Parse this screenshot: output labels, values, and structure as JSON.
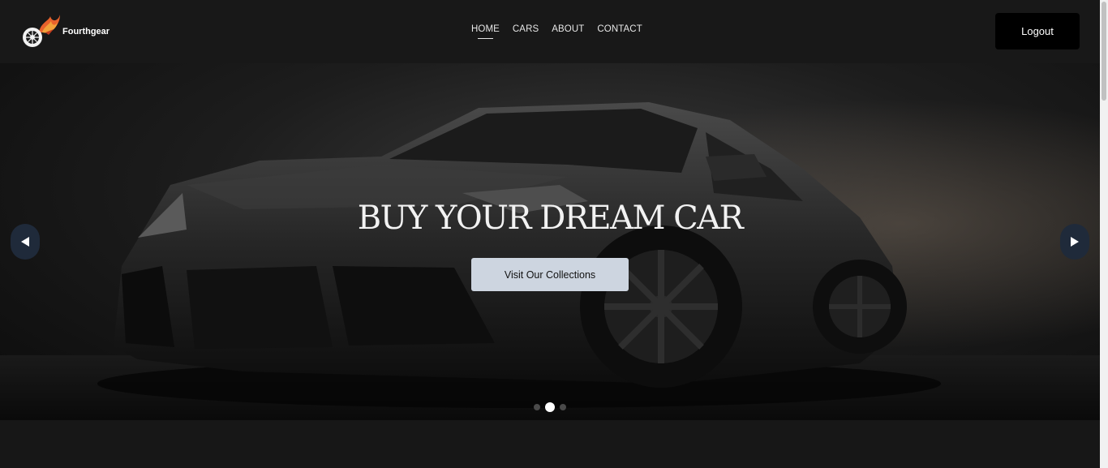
{
  "brand": {
    "name": "Fourthgear"
  },
  "nav": {
    "items": [
      {
        "label": "HOME",
        "active": true
      },
      {
        "label": "CARS",
        "active": false
      },
      {
        "label": "ABOUT",
        "active": false
      },
      {
        "label": "CONTACT",
        "active": false
      }
    ]
  },
  "header": {
    "logout_label": "Logout"
  },
  "hero": {
    "title": "BUY YOUR DREAM CAR",
    "cta_label": "Visit Our Collections",
    "prev_icon": "triangle-left-icon",
    "next_icon": "triangle-right-icon",
    "slides_total": 3,
    "slide_active": 2
  },
  "colors": {
    "page_bg": "#171717",
    "header_bg": "#181818",
    "logout_bg": "#000000",
    "cta_bg": "#cdd5e0",
    "arrow_bg": "#1f2a3a",
    "logo_flame": "#e8622c"
  }
}
